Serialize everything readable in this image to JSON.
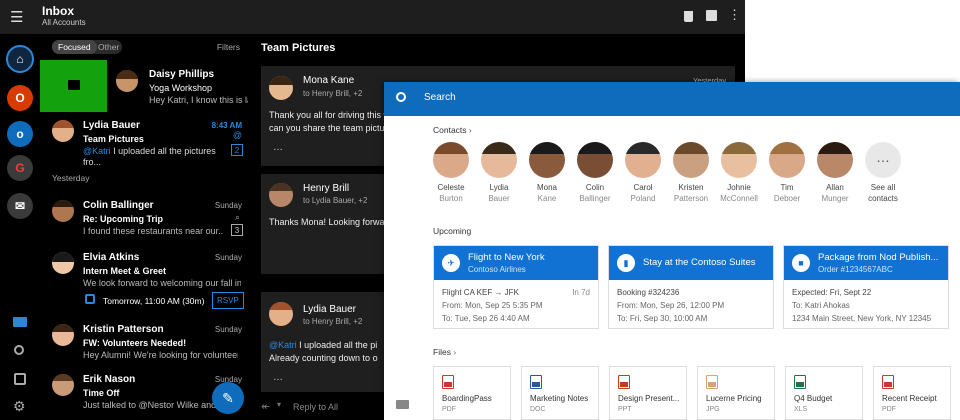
{
  "header": {
    "title": "Inbox",
    "subtitle": "All Accounts"
  },
  "tabs": {
    "focused": "Focused",
    "other": "Other",
    "filters": "Filters"
  },
  "messages": [
    {
      "name": "Daisy Phillips",
      "subject": "Yoga Workshop",
      "preview": "Hey Katri, I know this is last m",
      "time": ""
    },
    {
      "name": "Lydia Bauer",
      "subject": "Team Pictures",
      "preview_mention": "@Katri",
      "preview": " I uploaded all the pictures fro...",
      "time": "8:43 AM",
      "count": "2"
    },
    {
      "section": "Yesterday"
    },
    {
      "name": "Colin Ballinger",
      "subject": "Re: Upcoming Trip",
      "preview": "I found these restaurants near our...",
      "time": "Sunday",
      "count": "3"
    },
    {
      "name": "Elvia Atkins",
      "subject": "Intern Meet & Greet",
      "preview": "We look forward to welcoming our fall int...",
      "time": "Sunday",
      "event": "Tomorrow, 11:00 AM (30m)",
      "rsvp": "RSVP"
    },
    {
      "name": "Kristin Patterson",
      "subject": "FW: Volunteers Needed!",
      "preview": "Hey Alumni! We're looking for volunteers...",
      "time": "Sunday"
    },
    {
      "name": "Erik Nason",
      "subject": "Time Off",
      "preview": "Just talked to @Nestor Wilke and he will",
      "time": "Sunday"
    }
  ],
  "reader": {
    "title": "Team Pictures",
    "cards": [
      {
        "name": "Mona Kane",
        "to": "to Henry Brill, +2",
        "time": "Yesterday",
        "body": "Thank you all for driving this w",
        "body2": "can you share the team pictur"
      },
      {
        "name": "Henry Brill",
        "to": "to Lydia Bauer, +2",
        "body": "Thanks Mona! Looking forwa"
      },
      {
        "name": "Lydia Bauer",
        "to": "to Henry Brill, +2",
        "mention": "@Katri",
        "body": " I uploaded all the pi",
        "body2": "Already counting down to o"
      }
    ],
    "reply_all": "Reply to All"
  },
  "search": {
    "placeholder": "Search"
  },
  "contacts": {
    "label": "Contacts",
    "items": [
      {
        "first": "Celeste",
        "last": "Burton"
      },
      {
        "first": "Lydia",
        "last": "Bauer"
      },
      {
        "first": "Mona",
        "last": "Kane"
      },
      {
        "first": "Colin",
        "last": "Ballinger"
      },
      {
        "first": "Carol",
        "last": "Poland"
      },
      {
        "first": "Kristen",
        "last": "Patterson"
      },
      {
        "first": "Johnie",
        "last": "McConnell"
      },
      {
        "first": "Tim",
        "last": "Deboer"
      },
      {
        "first": "Allan",
        "last": "Munger"
      },
      {
        "first": "See all",
        "last": "contacts"
      }
    ]
  },
  "upcoming": {
    "label": "Upcoming",
    "items": [
      {
        "title": "Flight to New York",
        "sub": "Contoso Airlines",
        "l1": "Flight CA KEF → JFK",
        "l1r": "In 7d",
        "l2": "From: Mon, Sep 25 5:35 PM",
        "l3": "To: Tue, Sep 26 4:40 AM"
      },
      {
        "title": "Stay at the Contoso Suites",
        "sub": "",
        "l1": "Booking #324236",
        "l1r": "",
        "l2": "From: Mon, Sep 26, 12:00 PM",
        "l3": "To: Fri, Sep 30, 10:00 AM"
      },
      {
        "title": "Package from Nod Publish...",
        "sub": "Order #1234567ABC",
        "l1": "Expected: Fri, Sept 22",
        "l1r": "",
        "l2": "To: Katri Ahokas",
        "l3": "1234 Main Street, New York, NY 12345"
      }
    ]
  },
  "files": {
    "label": "Files",
    "items": [
      {
        "name": "BoardingPass",
        "type": "PDF",
        "color": "#d13438"
      },
      {
        "name": "Marketing Notes",
        "type": "DOC",
        "color": "#2b579a"
      },
      {
        "name": "Design Present...",
        "type": "PPT",
        "color": "#c43e1c"
      },
      {
        "name": "Lucerne Pricing",
        "type": "JPG",
        "color": "#d2a679"
      },
      {
        "name": "Q4 Budget",
        "type": "XLS",
        "color": "#217346"
      },
      {
        "name": "Recent Receipt",
        "type": "PDF",
        "color": "#d13438"
      }
    ]
  },
  "colors": {
    "accent": "#0f6cbd",
    "green": "#13a10e"
  }
}
